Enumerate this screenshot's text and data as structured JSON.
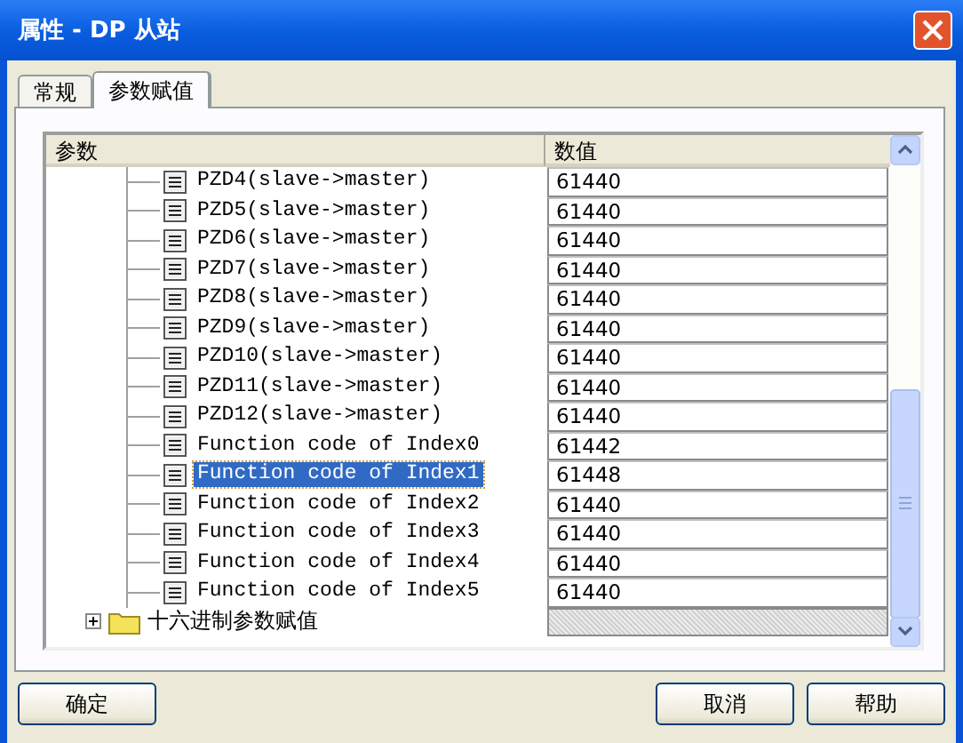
{
  "window": {
    "title": "属性 - DP 从站"
  },
  "tabs": [
    {
      "label": "常规",
      "selected": false
    },
    {
      "label": "参数赋值",
      "selected": true
    }
  ],
  "table": {
    "columns": [
      "参数",
      "数值"
    ],
    "rows": [
      {
        "kind": "param",
        "name": "PZD4(slave->master)",
        "value": "61440",
        "selected": false
      },
      {
        "kind": "param",
        "name": "PZD5(slave->master)",
        "value": "61440",
        "selected": false
      },
      {
        "kind": "param",
        "name": "PZD6(slave->master)",
        "value": "61440",
        "selected": false
      },
      {
        "kind": "param",
        "name": "PZD7(slave->master)",
        "value": "61440",
        "selected": false
      },
      {
        "kind": "param",
        "name": "PZD8(slave->master)",
        "value": "61440",
        "selected": false
      },
      {
        "kind": "param",
        "name": "PZD9(slave->master)",
        "value": "61440",
        "selected": false
      },
      {
        "kind": "param",
        "name": "PZD10(slave->master)",
        "value": "61440",
        "selected": false
      },
      {
        "kind": "param",
        "name": "PZD11(slave->master)",
        "value": "61440",
        "selected": false
      },
      {
        "kind": "param",
        "name": "PZD12(slave->master)",
        "value": "61440",
        "selected": false
      },
      {
        "kind": "param",
        "name": "Function code of Index0",
        "value": "61442",
        "selected": false
      },
      {
        "kind": "param",
        "name": "Function code of Index1",
        "value": "61448",
        "selected": true
      },
      {
        "kind": "param",
        "name": "Function code of Index2",
        "value": "61440",
        "selected": false
      },
      {
        "kind": "param",
        "name": "Function code of Index3",
        "value": "61440",
        "selected": false
      },
      {
        "kind": "param",
        "name": "Function code of Index4",
        "value": "61440",
        "selected": false
      },
      {
        "kind": "param",
        "name": "Function code of Index5",
        "value": "61440",
        "selected": false
      },
      {
        "kind": "folder",
        "name": "十六进制参数赋值",
        "expanded": false,
        "selected": false
      }
    ]
  },
  "buttons": [
    {
      "label": "确定"
    },
    {
      "label": "取消"
    },
    {
      "label": "帮助"
    }
  ]
}
